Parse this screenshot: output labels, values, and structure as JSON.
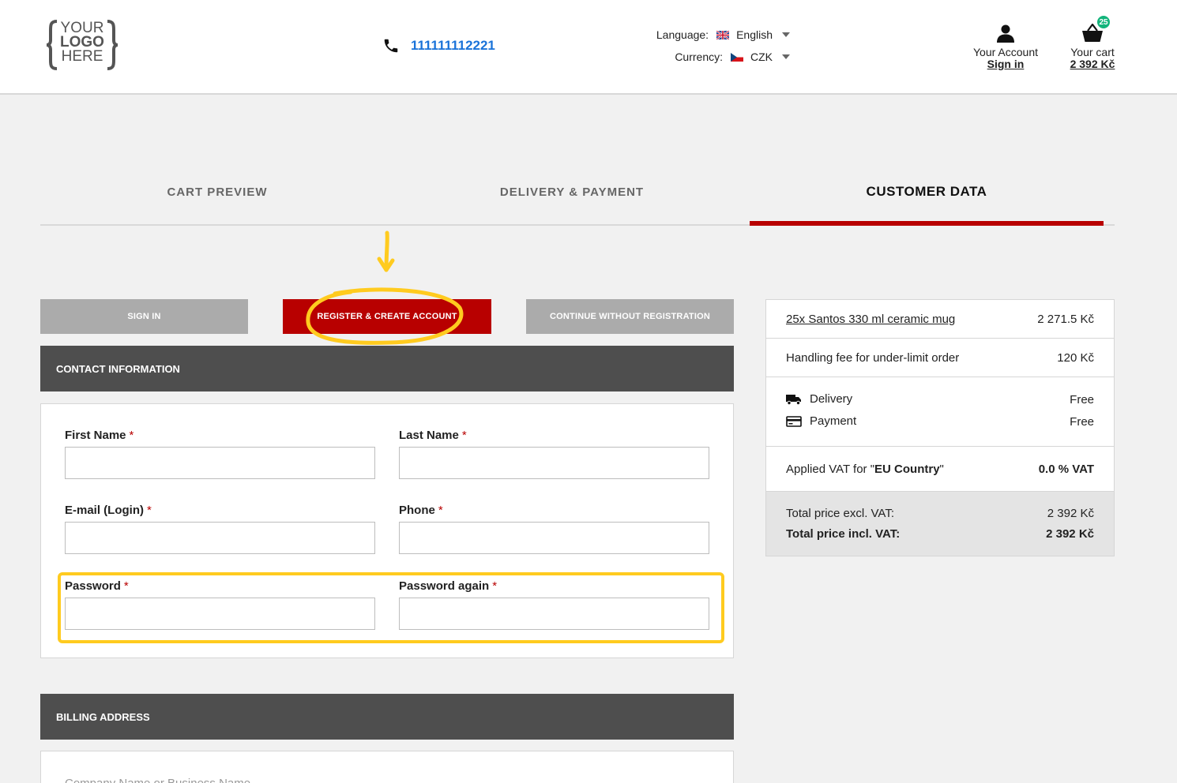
{
  "header": {
    "logo": {
      "line1": "YOUR",
      "line2": "LOGO",
      "line3": "HERE"
    },
    "phone": "111111112221",
    "language_label": "Language:",
    "language_value": "English",
    "currency_label": "Currency:",
    "currency_value": "CZK",
    "account_label": "Your Account",
    "account_link": "Sign in",
    "cart_label": "Your cart",
    "cart_total": "2 392 Kč",
    "cart_count": "25"
  },
  "steps": [
    {
      "label": "CART PREVIEW",
      "active": false
    },
    {
      "label": "DELIVERY & PAYMENT",
      "active": false
    },
    {
      "label": "CUSTOMER DATA",
      "active": true
    }
  ],
  "tabs": {
    "sign_in": "SIGN IN",
    "register": "REGISTER & CREATE ACCOUNT",
    "guest": "CONTINUE WITHOUT REGISTRATION"
  },
  "contact": {
    "heading": "CONTACT INFORMATION",
    "first_name": "First Name",
    "last_name": "Last Name",
    "email": "E-mail (Login)",
    "phone": "Phone",
    "password": "Password",
    "password_again": "Password again",
    "required_mark": "*"
  },
  "billing": {
    "heading": "BILLING ADDRESS",
    "company_name": "Company Name or Business Name"
  },
  "summary": {
    "item_name": "25x Santos 330 ml ceramic mug",
    "item_price": "2 271.5 Kč",
    "fee_label": "Handling fee for under-limit order",
    "fee_price": "120 Kč",
    "delivery_label": "Delivery",
    "delivery_value": "Free",
    "payment_label": "Payment",
    "payment_value": "Free",
    "vat_prefix": "Applied VAT for \"",
    "vat_country": "EU Country",
    "vat_suffix": "\"",
    "vat_value": "0.0 % VAT",
    "total_excl_label": "Total price excl. VAT:",
    "total_excl_value": "2 392 Kč",
    "total_incl_label": "Total price incl. VAT:",
    "total_incl_value": "2 392 Kč"
  },
  "colors": {
    "brand_red": "#b80000",
    "annotation_yellow": "#ffcb1f",
    "phone_blue": "#1a73d9",
    "badge_green": "#13b47b"
  }
}
